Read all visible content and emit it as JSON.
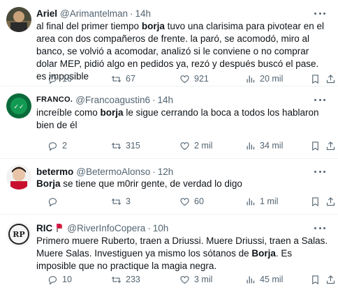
{
  "tweets": [
    {
      "name": "Ariel",
      "handle": "@Arimantelman",
      "time": "14h",
      "verified": false,
      "text_parts": [
        {
          "t": "al final del primer tiempo ",
          "b": false
        },
        {
          "t": "borja",
          "b": true
        },
        {
          "t": " tuvo una clarisima para pivotear en el area con dos compañeros de frente. la paró, se acomodó, miro al banco, se volvió a acomodar, analizó si le conviene o no comprar dolar MEP, pidió algo en pedidos ya, rezó y después buscó el pase. es imposible",
          "b": false
        }
      ],
      "replies": "16",
      "retweets": "67",
      "likes": "921",
      "views": "20 mil"
    },
    {
      "name": "FRANCO.",
      "handle": "@Francoagustin6",
      "time": "14h",
      "verified": false,
      "text_parts": [
        {
          "t": "increíble como ",
          "b": false
        },
        {
          "t": "borja",
          "b": true
        },
        {
          "t": " le sigue cerrando la boca a todos los hablaron bien de él",
          "b": false
        }
      ],
      "replies": "2",
      "retweets": "315",
      "likes": "2 mil",
      "views": "34 mil"
    },
    {
      "name": "betermo",
      "handle": "@BetermoAlonso",
      "time": "12h",
      "verified": false,
      "text_parts": [
        {
          "t": "Borja",
          "b": true
        },
        {
          "t": " se tiene que m0rir gente, de verdad lo digo",
          "b": false
        }
      ],
      "replies": "",
      "retweets": "3",
      "likes": "60",
      "views": "1 mil"
    },
    {
      "name": "RIC",
      "handle": "@RiverInfoCopera",
      "time": "10h",
      "verified": true,
      "text_parts": [
        {
          "t": "Primero muere Ruberto, traen a Driussi. Muere Driussi, traen a Salas. Muere Salas. Investiguen ya mismo los sótanos de ",
          "b": false
        },
        {
          "t": "Borja",
          "b": true
        },
        {
          "t": ". Es imposible que no practique la magia negra.",
          "b": false
        }
      ],
      "replies": "10",
      "retweets": "233",
      "likes": "3 mil",
      "views": "45 mil"
    }
  ],
  "colors": {
    "text": "#0f1419",
    "muted": "#536471",
    "divider": "#eff3f4",
    "verified_badge": "#e0245e"
  },
  "icons": [
    "reply-icon",
    "retweet-icon",
    "like-icon",
    "views-icon",
    "bookmark-icon",
    "share-icon",
    "more-icon"
  ]
}
